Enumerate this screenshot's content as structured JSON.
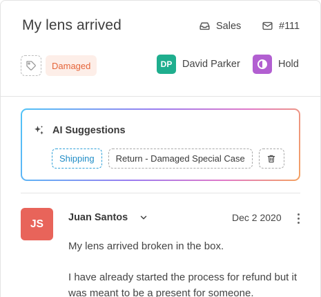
{
  "ticket": {
    "title": "My lens arrived",
    "inbox": "Sales",
    "number": "#111",
    "tag": "Damaged",
    "assignee_initials": "DP",
    "assignee_name": "David Parker",
    "status": "Hold"
  },
  "ai": {
    "title": "AI Suggestions",
    "suggestions": [
      "Shipping",
      "Return - Damaged Special Case"
    ]
  },
  "message": {
    "author_initials": "JS",
    "author": "Juan Santos",
    "date": "Dec 2 2020",
    "lines": [
      "My lens arrived broken in the box.",
      "I have already started the process for refund but it was meant to be a present for someone."
    ]
  },
  "colors": {
    "damaged_bg": "#fdeee8",
    "damaged_text": "#e5653a",
    "assignee_avatar": "#1fae8e",
    "status_icon": "#b25fd1",
    "author_avatar": "#e8645a",
    "shipping_chip": "#2d9fd8"
  },
  "icons": {
    "inbox": "inbox-icon",
    "ticket_number": "envelope-icon",
    "tag": "tag-icon",
    "status": "half-circle-icon",
    "ai": "sparkle-icon",
    "trash": "trash-icon",
    "expand": "chevron-down-icon",
    "more": "more-vertical-icon"
  }
}
